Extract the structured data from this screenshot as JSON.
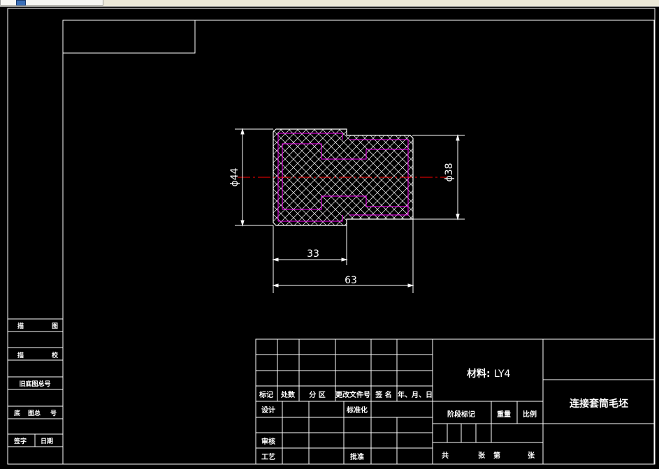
{
  "window": {
    "tab_label": ""
  },
  "part": {
    "diameter_large": "ϕ44",
    "diameter_small": "ϕ38",
    "length_step": "33",
    "length_total": "63"
  },
  "side_block": {
    "row1": [
      "描",
      "图"
    ],
    "row2": [
      "描",
      "校"
    ],
    "row3": "旧底图总号",
    "row4": [
      "底",
      "图总",
      "号"
    ],
    "row5": [
      "签字",
      "日期"
    ]
  },
  "title_block": {
    "header_labels": [
      "标记",
      "处数",
      "分 区",
      "更改文件号",
      "签 名",
      "年、月、日"
    ],
    "design": "设计",
    "standardization": "标准化",
    "review": "审核",
    "process": "工艺",
    "approve": "批准",
    "material_label": "材料:",
    "material_value": "LY4",
    "stage_mark": "阶段标记",
    "weight": "重量",
    "scale": "比例",
    "sheet_total": "共",
    "sheet_word": "张",
    "sheet_of": "第",
    "sheet_word2": "张",
    "drawing_name": "连接套筒毛坯"
  },
  "colors": {
    "frame": "#ffffff",
    "outline_magenta": "#ff00ff",
    "centerline": "#ff0000",
    "background": "#000000"
  }
}
